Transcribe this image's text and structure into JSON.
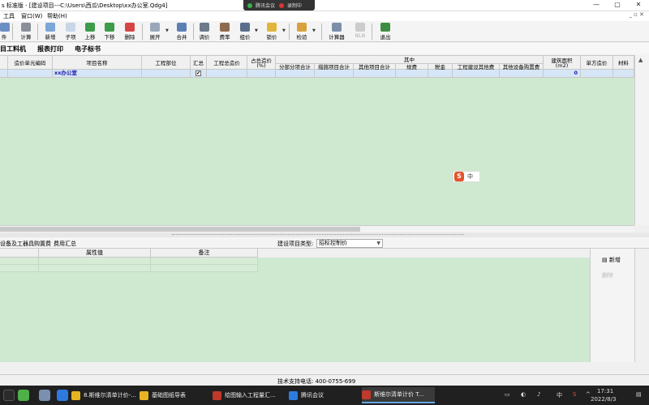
{
  "window": {
    "title": "s 标准版 - [建设项目---C:\\Users\\西瓜\\Desktop\\xx办公室.Qdg4]",
    "meeting": {
      "app": "腾讯会议",
      "recording": "录制中"
    },
    "controls": {
      "minimize": "—",
      "maximize": "▢",
      "close": "✕"
    }
  },
  "menu": {
    "items": [
      "工具",
      "窗口(W)",
      "帮助(H)"
    ],
    "right": "_ ▫ ✕"
  },
  "toolbar": {
    "buttons": [
      "件",
      "计算",
      "新增",
      "子项",
      "上移",
      "下移",
      "删除",
      "展开",
      "合并",
      "调价",
      "费率",
      "组价",
      "锁价",
      "检验",
      "计算器",
      "BLB",
      "退出"
    ]
  },
  "tabs": [
    "目工料机",
    "报表打印",
    "电子标书"
  ],
  "grid": {
    "headers": {
      "unit_code": "造价单元编码",
      "item_name": "项目名称",
      "dept": "工程部位",
      "summary": "汇总",
      "total": "工程总造价",
      "pct_top": "占总造价",
      "pct_bottom": "(%)",
      "among": "其中",
      "sub1": "分部分项合计",
      "sub2": "措施项目合计",
      "sub3": "其他项目合计",
      "sub4": "规费",
      "sub5": "税金",
      "sub6": "工程建设其他费",
      "sub7": "其他设备购置费",
      "area_top": "建筑面积",
      "area_bottom": "(m2)",
      "unit_price": "单方造价",
      "material": "材料"
    },
    "row": {
      "name": "xx办公室",
      "area_value": "0",
      "check": "✔"
    }
  },
  "ime": {
    "icon": "S",
    "mode": "中"
  },
  "lower": {
    "tabs": [
      "设备及工器具购置费",
      "费用汇总"
    ],
    "project_type_label": "建设项目类型:",
    "project_type_value": "招标控制价",
    "prop_headers": {
      "value": "属性值",
      "note": "备注"
    },
    "side_buttons": {
      "add": "新增",
      "delete": "删除"
    }
  },
  "status": {
    "support": "技术支持电话: 400-0755-699"
  },
  "taskbar": {
    "apps": [
      {
        "label": "8.斯维尔清单计价-...",
        "color": "#e6b422"
      },
      {
        "label": "基础图纸导表",
        "color": "#e6b422"
      },
      {
        "label": "绘图输入工程量汇...",
        "color": "#c0392b"
      },
      {
        "label": "腾讯会议",
        "color": "#2d7be0"
      },
      {
        "label": "斯维尔清单计价 T...",
        "color": "#c0392b"
      }
    ],
    "tray": {
      "lang": "中",
      "time": "17:31",
      "date": "2022/8/3"
    }
  },
  "colors": {
    "grid_bg": "#cfe8d0",
    "row_highlight": "#d6e6f7",
    "name_text": "#1a1aa8"
  }
}
